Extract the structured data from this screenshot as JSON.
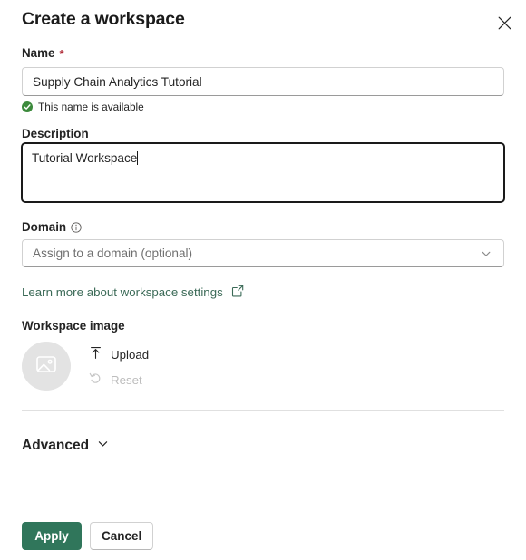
{
  "dialog": {
    "title": "Create a workspace",
    "close_icon": "close-icon"
  },
  "name_field": {
    "label": "Name",
    "required_marker": "*",
    "value": "Supply Chain Analytics Tutorial",
    "placeholder": "",
    "validation_text": "This name is available",
    "validation_icon": "checkmark-circle-icon",
    "validation_color": "#3c8a3c"
  },
  "description_field": {
    "label": "Description",
    "value": "Tutorial Workspace",
    "placeholder": "",
    "focused": true
  },
  "domain_field": {
    "label": "Domain",
    "info_icon": "info-icon",
    "placeholder": "Assign to a domain (optional)",
    "selected_value": "",
    "chevron_icon": "chevron-down-icon"
  },
  "learn_more": {
    "label": "Learn more about workspace settings",
    "icon": "external-link-icon",
    "color": "#3b6a57"
  },
  "workspace_image": {
    "label": "Workspace image",
    "placeholder_icon": "image-placeholder-icon",
    "upload": {
      "label": "Upload",
      "icon": "upload-icon",
      "enabled": true
    },
    "reset": {
      "label": "Reset",
      "icon": "reset-arrow-icon",
      "enabled": false
    }
  },
  "advanced": {
    "label": "Advanced",
    "chevron_icon": "chevron-down-icon",
    "expanded": false
  },
  "footer": {
    "apply_label": "Apply",
    "cancel_label": "Cancel",
    "apply_color": "#30765b"
  }
}
